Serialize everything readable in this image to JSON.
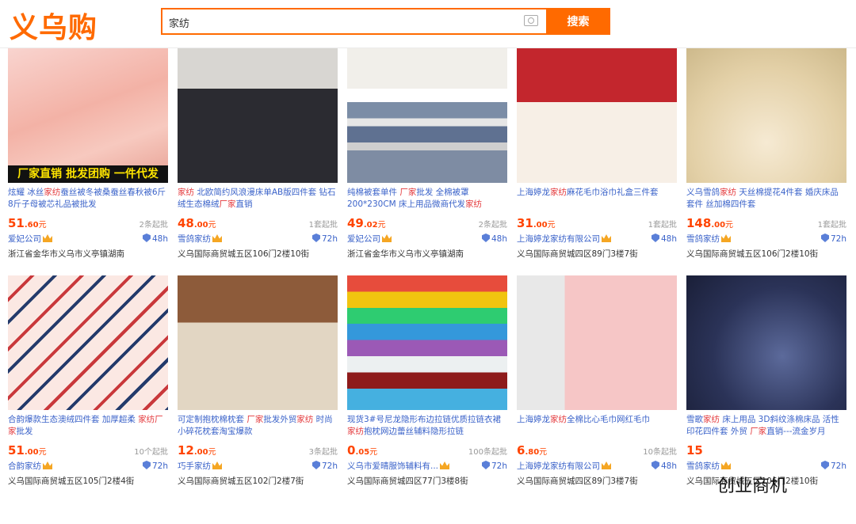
{
  "header": {
    "logo": "义乌购",
    "search_value": "家纺",
    "search_button": "搜索"
  },
  "products": [
    {
      "img": "pink-quilt",
      "banner": "厂家直销 批发团购 一件代发",
      "title_html": "炫耀 冰丝<span class='hl'>家纺</span>蚕丝被冬被桑蚕丝春秋被6斤8斤子母被芯礼品被批发",
      "price_int": "51",
      "price_dec": ".60",
      "unit": "元",
      "moq": "2条起批",
      "shop": "爱妃公司",
      "ship": "48h",
      "addr": "浙江省金华市义乌市义亭镇湖南"
    },
    {
      "img": "black-bedding",
      "title_html": "<span class='hl'>家纺</span> 北欧简约风浪漫床单AB版四件套 钻石绒生态棉绒<span class='hl'>厂家</span>直销",
      "price_int": "48",
      "price_dec": ".00",
      "unit": "元",
      "moq": "1套起批",
      "shop": "雪鸽家纺",
      "ship": "72h",
      "addr": "义乌国际商贸城五区106门2楼10街"
    },
    {
      "img": "striped-bedding",
      "title_html": "纯棉被套单件 <span class='hl'>厂家</span>批发 全棉被罩200*230CM 床上用品微商代发<span class='hl'>家纺</span>",
      "price_int": "49",
      "price_dec": ".02",
      "unit": "元",
      "moq": "2条起批",
      "shop": "爱妃公司",
      "ship": "48h",
      "addr": "浙江省金华市义乌市义亭镇湖南"
    },
    {
      "img": "towel-box",
      "title_html": "上海婷龙<span class='hl'>家纺</span>麻花毛巾浴巾礼盒三件套",
      "price_int": "31",
      "price_dec": ".00",
      "unit": "元",
      "moq": "1套起批",
      "shop": "上海婷龙家纺有限公司",
      "ship": "48h",
      "addr": "义乌国际商贸城四区89门3楼7街"
    },
    {
      "img": "jacquard-bedding",
      "title_html": "义乌雪鸽<span class='hl'>家纺</span> 天丝棉提花4件套 婚庆床品套件 丝加棉四件套",
      "price_int": "148",
      "price_dec": ".00",
      "unit": "元",
      "moq": "1套起批",
      "shop": "雪鸽家纺",
      "ship": "72h",
      "addr": "义乌国际商贸城五区106门2楼10街"
    },
    {
      "img": "flower-bedding",
      "title_html": "合韵爆款生态澳绒四件套 加厚超柔 <span class='hl'>家纺厂家</span>批发",
      "price_int": "51",
      "price_dec": ".00",
      "unit": "元",
      "moq": "10个起批",
      "shop": "合韵家纺",
      "ship": "72h",
      "addr": "义乌国际商贸城五区105门2楼4街"
    },
    {
      "img": "pillows",
      "title_html": "可定制抱枕棉枕套 <span class='hl'>厂家</span>批发外贸<span class='hl'>家纺</span> 时尚小碎花枕套淘宝爆款",
      "price_int": "12",
      "price_dec": ".00",
      "unit": "元",
      "moq": "3条起批",
      "shop": "巧手家纺",
      "ship": "72h",
      "addr": "义乌国际商贸城五区102门2楼7街"
    },
    {
      "img": "zippers",
      "title_html": "现货3#号尼龙隐形布边拉链优质拉链衣裙<span class='hl'>家纺</span>抱枕网边蕾丝辅料隐形拉链",
      "price_int": "0",
      "price_dec": ".05",
      "unit": "元",
      "moq": "100条起批",
      "shop": "义乌市爱晴服饰辅料有...",
      "ship": "72h",
      "addr": "义乌国际商贸城四区77门3楼8街"
    },
    {
      "img": "pink-towel",
      "title_html": "上海婷龙<span class='hl'>家纺</span>全棉比心毛巾网红毛巾",
      "price_int": "6",
      "price_dec": ".80",
      "unit": "元",
      "moq": "10条起批",
      "shop": "上海婷龙家纺有限公司",
      "ship": "48h",
      "addr": "义乌国际商贸城四区89门3楼7街"
    },
    {
      "img": "paisley-bedding",
      "title_html": "雪歌<span class='hl'>家纺</span> 床上用品 3D斜纹涤棉床品 活性印花四件套 外贸 <span class='hl'>厂家</span>直销---流金岁月",
      "price_int": "15",
      "price_dec": "",
      "unit": "",
      "moq": "",
      "shop": "雪鸽家纺",
      "ship": "72h",
      "addr": "义乌国际商贸城五区106门2楼10街"
    }
  ],
  "watermark": "创业商机"
}
